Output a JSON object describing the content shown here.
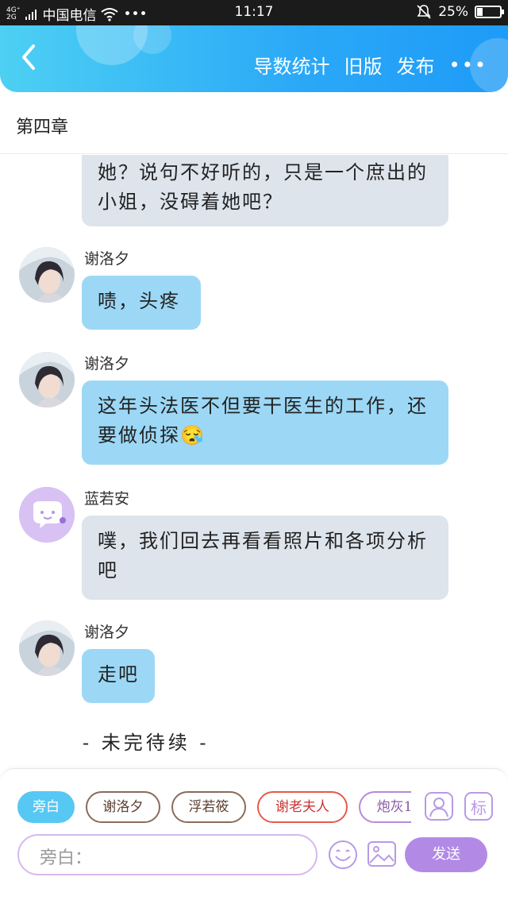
{
  "status_bar": {
    "network_top": "4G⁺",
    "network_bottom": "2G",
    "carrier": "中国电信",
    "dots": "•••",
    "time": "11:17",
    "battery": "25%",
    "battery_level": 0.25
  },
  "header": {
    "back_icon": "chevron-left-icon",
    "actions": [
      "导数统计",
      "旧版",
      "发布"
    ],
    "more": "•••"
  },
  "chapter": {
    "title": "第四章"
  },
  "messages": [
    {
      "speaker": "",
      "text": "她？说句不好听的，只是一个庶出的小姐，没碍着她吧？",
      "style": "gray"
    },
    {
      "speaker": "谢洛夕",
      "text": "啧，头疼",
      "style": "blue"
    },
    {
      "speaker": "谢洛夕",
      "text": "这年头法医不但要干医生的工作，还要做侦探😪",
      "style": "blue"
    },
    {
      "speaker": "蓝若安",
      "text": "噗，我们回去再看看照片和各项分析吧",
      "style": "gray"
    },
    {
      "speaker": "谢洛夕",
      "text": "走吧",
      "style": "blue"
    }
  ],
  "ending": "- 未完待续 -",
  "composer": {
    "roles": [
      "旁白",
      "谢洛夕",
      "浮若筱",
      "谢老夫人",
      "炮灰1"
    ],
    "active_role": "旁白",
    "input_placeholder": "旁白：",
    "send_label": "发送",
    "icons": [
      "add-role-icon",
      "mark-icon",
      "emoji-icon",
      "image-icon"
    ],
    "mark_label": "标"
  },
  "colors": {
    "header_start": "#4dd0f3",
    "header_end": "#1e9bf7",
    "bubble_gray": "#dde4ec",
    "bubble_blue": "#9cd8f6",
    "send": "#b28ae6",
    "active_chip": "#56c8f3"
  }
}
